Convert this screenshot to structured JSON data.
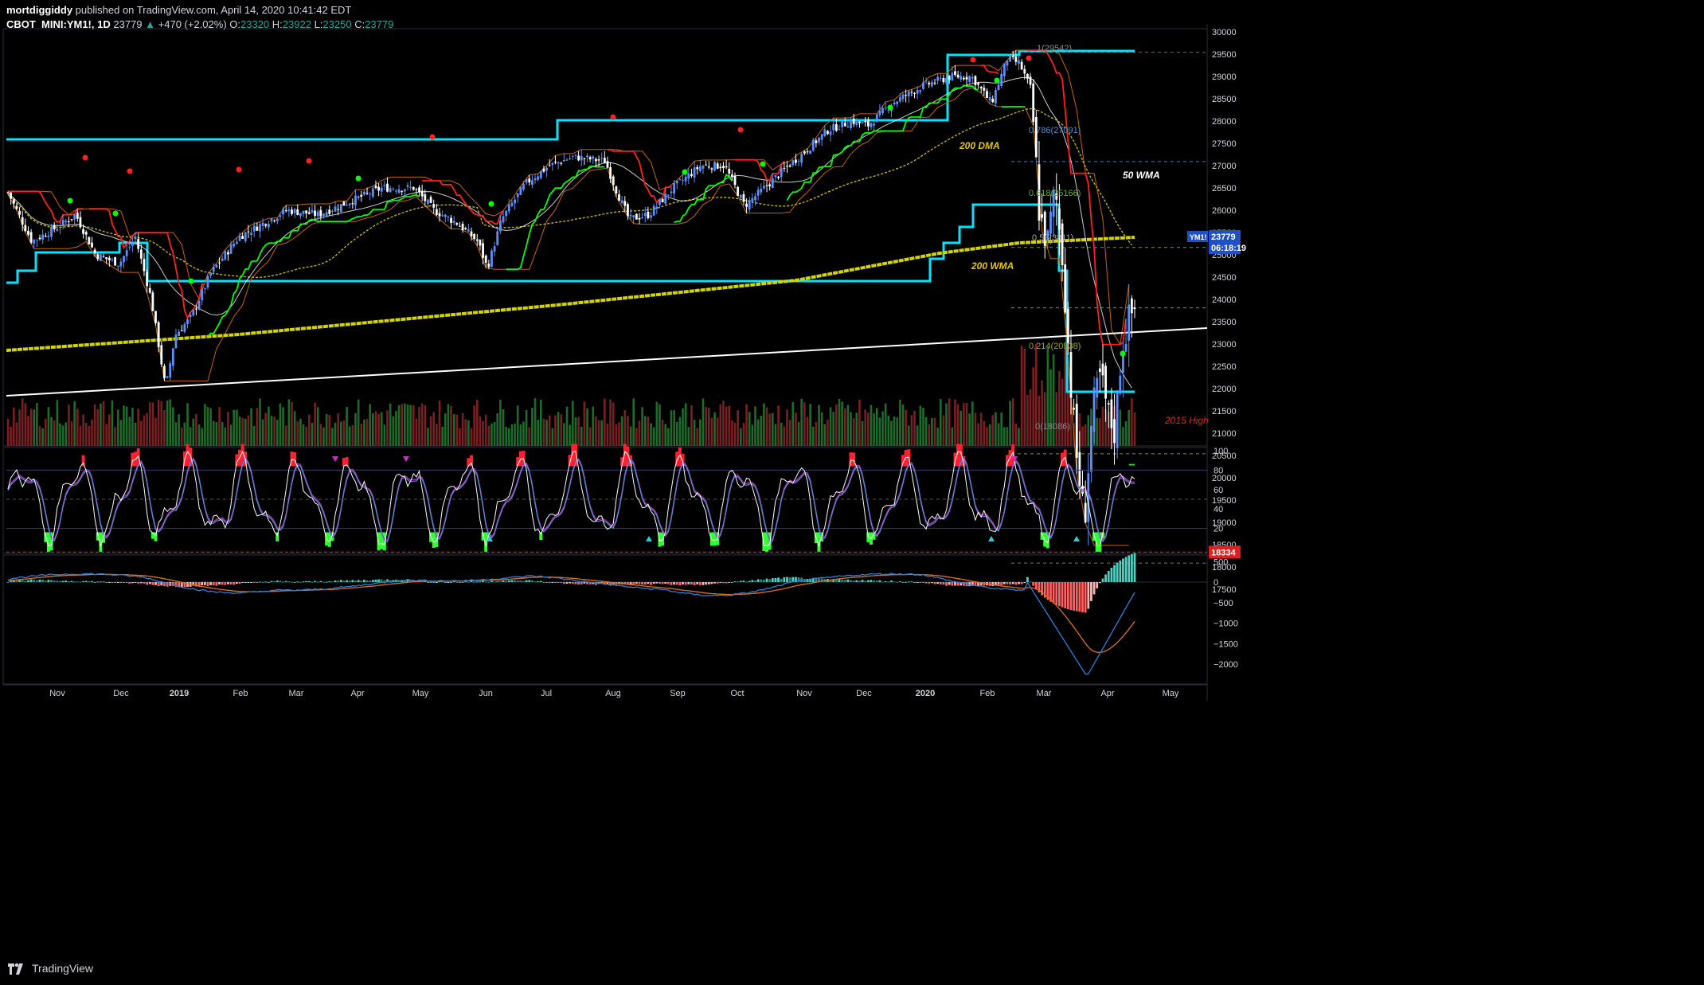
{
  "header": {
    "author": "mortdiggiddy",
    "published": "published on TradingView.com, April 14, 2020 10:41:42 EDT",
    "symbol": "CBOT_MINI:YM1!, 1D",
    "last": "23779",
    "change": "+470 (+2.02%)",
    "open_label": "O:",
    "open": "23320",
    "high_label": "H:",
    "high": "23922",
    "low_label": "L:",
    "low": "23250",
    "close_label": "C:",
    "close": "23779"
  },
  "footer": {
    "brand": "TradingView"
  },
  "price_axis": {
    "ticks": [
      "30000",
      "29500",
      "29000",
      "28500",
      "28000",
      "27500",
      "27000",
      "26500",
      "26000",
      "25500",
      "25000",
      "24500",
      "24000",
      "23500",
      "23000",
      "22500",
      "22000",
      "21500",
      "21000",
      "20500",
      "20000",
      "19500",
      "19000",
      "18500",
      "18000",
      "17500"
    ],
    "last_tag": "YM1!",
    "last_value": "23779",
    "countdown": "06:18:19",
    "level_tag": "18334"
  },
  "time_axis": {
    "labels": [
      "Nov",
      "Dec",
      "2019",
      "Feb",
      "Mar",
      "Apr",
      "May",
      "Jun",
      "Jul",
      "Aug",
      "Sep",
      "Oct",
      "Nov",
      "Dec",
      "2020",
      "Feb",
      "Mar",
      "Apr",
      "May"
    ]
  },
  "annotations": {
    "dma200": "200 DMA",
    "wma50": "50 WMA",
    "wma200": "200 WMA",
    "high2015": "2015 High",
    "fib_1": "1(29542)",
    "fib_0786": "0.786(27091)",
    "fib_0618": "0.618(25166)",
    "fib_05": "0.5(23811)",
    "fib_0214": "0.214(20538)",
    "fib_0": "0(18086)"
  },
  "stoch_axis": {
    "ticks": [
      "100",
      "80",
      "60",
      "40",
      "20",
      "0"
    ]
  },
  "macd_axis": {
    "ticks": [
      "500",
      "0",
      "−500",
      "−1000",
      "−1500",
      "−2000"
    ]
  },
  "colors": {
    "background": "#000000",
    "up": "#5b8ff9",
    "down": "#ffffff",
    "donchian": "#00e5ff",
    "supertrend_up": "#00ff00",
    "supertrend_down": "#ff2020",
    "ma200d": "#c8b400",
    "wma200": "#d4d400",
    "wma50": "#ffffff",
    "orange_band": "#c86400",
    "stoch_k": "#ffffff",
    "stoch_d": "#4a90d9",
    "macd": "#2f7fd6",
    "signal": "#e07020"
  },
  "chart_data": {
    "type": "candlestick",
    "symbol": "CBOT_MINI:YM1!",
    "interval": "1D",
    "x_range": [
      "Oct 2018",
      "May 2020"
    ],
    "ylim": [
      17500,
      30000
    ],
    "levels": {
      "fib_1": 29542,
      "fib_0786": 27091,
      "fib_0618": 25166,
      "fib_05": 23811,
      "fib_0214": 20538,
      "fib_0": 18086,
      "high_2015": 18334
    },
    "closes_by_month": [
      {
        "x": "Oct 2018",
        "close": 25100
      },
      {
        "x": "Nov 2018",
        "close": 25500
      },
      {
        "x": "Dec 2018",
        "close": 23300
      },
      {
        "x": "Jan 2019",
        "close": 25000
      },
      {
        "x": "Feb 2019",
        "close": 26000
      },
      {
        "x": "Mar 2019",
        "close": 25900
      },
      {
        "x": "Apr 2019",
        "close": 26600
      },
      {
        "x": "May 2019",
        "close": 24800
      },
      {
        "x": "Jun 2019",
        "close": 26700
      },
      {
        "x": "Jul 2019",
        "close": 26900
      },
      {
        "x": "Aug 2019",
        "close": 26300
      },
      {
        "x": "Sep 2019",
        "close": 26900
      },
      {
        "x": "Oct 2019",
        "close": 27000
      },
      {
        "x": "Nov 2019",
        "close": 28000
      },
      {
        "x": "Dec 2019",
        "close": 28500
      },
      {
        "x": "Jan 2020",
        "close": 28300
      },
      {
        "x": "Feb 2020",
        "close": 25400
      },
      {
        "x": "Mar 2020",
        "close": 21900
      },
      {
        "x": "Apr 2020",
        "close": 23779
      }
    ],
    "stochastic": {
      "ylim": [
        0,
        100
      ],
      "levels": [
        80,
        50,
        20
      ]
    },
    "macd": {
      "ylim": [
        -2500,
        700
      ],
      "min_macd": -2300,
      "min_signal": -2000
    }
  }
}
